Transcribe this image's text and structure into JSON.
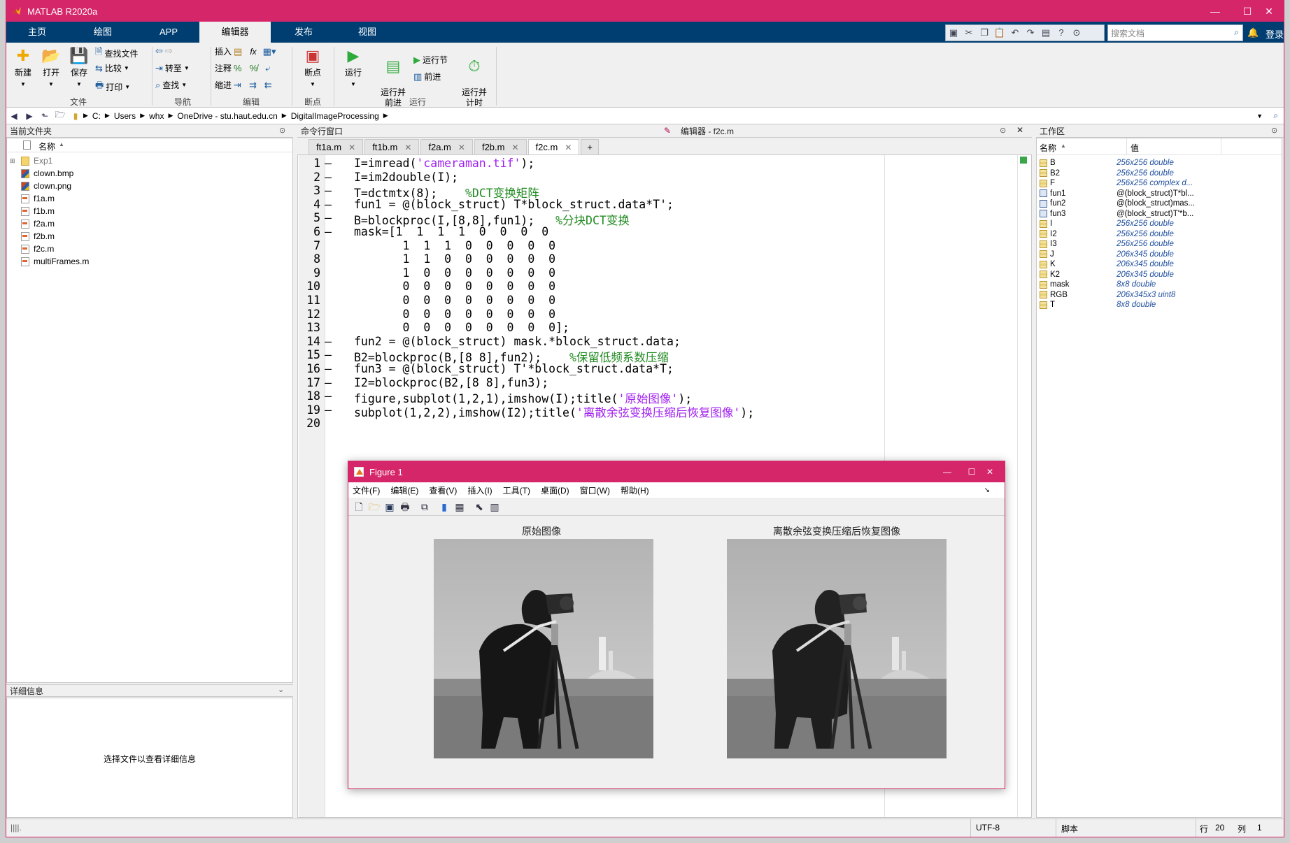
{
  "app": {
    "title": "MATLAB R2020a",
    "login_label": "登录"
  },
  "window_controls": {
    "minimize": "—",
    "maximize": "☐",
    "close": "✕"
  },
  "tabs": [
    {
      "label": "主页"
    },
    {
      "label": "绘图"
    },
    {
      "label": "APP"
    },
    {
      "label": "编辑器",
      "active": true
    },
    {
      "label": "发布"
    },
    {
      "label": "视图"
    }
  ],
  "search": {
    "placeholder": "搜索文档"
  },
  "ribbon": {
    "file": {
      "group_label": "文件",
      "new": "新建",
      "open": "打开",
      "save": "保存",
      "find_files": "查找文件",
      "compare": "比较",
      "print": "打印"
    },
    "navigate": {
      "group_label": "导航",
      "goto": "转至",
      "find": "查找"
    },
    "edit": {
      "group_label": "编辑",
      "insert": "插入",
      "comment": "注释",
      "indent": "缩进",
      "fx": "fx"
    },
    "breakpoints": {
      "group_label": "断点",
      "breakpoints": "断点"
    },
    "run": {
      "group_label": "运行",
      "run": "运行",
      "run_advance": "运行并\n前进",
      "run_section": "运行节",
      "advance": "前进",
      "run_time": "运行并\n计时"
    }
  },
  "address": {
    "crumbs": [
      "C:",
      "Users",
      "whx",
      "OneDrive - stu.haut.edu.cn",
      "DigitalImageProcessing"
    ]
  },
  "current_folder": {
    "title": "当前文件夹",
    "column": "名称",
    "files": [
      {
        "name": "Exp1",
        "type": "folder"
      },
      {
        "name": "clown.bmp",
        "type": "img"
      },
      {
        "name": "clown.png",
        "type": "img"
      },
      {
        "name": "f1a.m",
        "type": "m"
      },
      {
        "name": "f1b.m",
        "type": "m"
      },
      {
        "name": "f2a.m",
        "type": "m"
      },
      {
        "name": "f2b.m",
        "type": "m"
      },
      {
        "name": "f2c.m",
        "type": "m"
      },
      {
        "name": "multiFrames.m",
        "type": "m"
      }
    ]
  },
  "details": {
    "title": "详细信息",
    "empty_text": "选择文件以查看详细信息"
  },
  "command_window": {
    "title": "命令行窗口"
  },
  "editor": {
    "title": "编辑器 - f2c.m",
    "tabs": [
      "ft1a.m",
      "ft1b.m",
      "f2a.m",
      "f2b.m",
      "f2c.m"
    ],
    "active_tab": "f2c.m",
    "add_tab": "+",
    "lines": [
      {
        "n": "1",
        "dash": "–",
        "parts": [
          [
            "I=imread(",
            ""
          ],
          [
            "'cameraman.tif'",
            "str"
          ],
          [
            ");",
            ""
          ]
        ]
      },
      {
        "n": "2",
        "dash": "–",
        "parts": [
          [
            "I=im2double(I);",
            ""
          ]
        ]
      },
      {
        "n": "3",
        "dash": "–",
        "parts": [
          [
            "T=dctmtx(8);    ",
            ""
          ],
          [
            "%DCT变换矩阵",
            "cmt"
          ]
        ]
      },
      {
        "n": "4",
        "dash": "–",
        "parts": [
          [
            "fun1 = @(block_struct) T*block_struct.data*T';",
            ""
          ]
        ]
      },
      {
        "n": "5",
        "dash": "–",
        "parts": [
          [
            "B=blockproc(I,[8,8],fun1);   ",
            ""
          ],
          [
            "%分块DCT变换",
            "cmt"
          ]
        ]
      },
      {
        "n": "6",
        "dash": "–",
        "parts": [
          [
            "mask=[1  1  1  1  0  0  0  0",
            ""
          ]
        ]
      },
      {
        "n": "7",
        "dash": "",
        "parts": [
          [
            "       1  1  1  0  0  0  0  0",
            ""
          ]
        ]
      },
      {
        "n": "8",
        "dash": "",
        "parts": [
          [
            "       1  1  0  0  0  0  0  0",
            ""
          ]
        ]
      },
      {
        "n": "9",
        "dash": "",
        "parts": [
          [
            "       1  0  0  0  0  0  0  0",
            ""
          ]
        ]
      },
      {
        "n": "10",
        "dash": "",
        "parts": [
          [
            "       0  0  0  0  0  0  0  0",
            ""
          ]
        ]
      },
      {
        "n": "11",
        "dash": "",
        "parts": [
          [
            "       0  0  0  0  0  0  0  0",
            ""
          ]
        ]
      },
      {
        "n": "12",
        "dash": "",
        "parts": [
          [
            "       0  0  0  0  0  0  0  0",
            ""
          ]
        ]
      },
      {
        "n": "13",
        "dash": "",
        "parts": [
          [
            "       0  0  0  0  0  0  0  0];",
            ""
          ]
        ]
      },
      {
        "n": "14",
        "dash": "–",
        "parts": [
          [
            "fun2 = @(block_struct) mask.*block_struct.data;",
            ""
          ]
        ]
      },
      {
        "n": "15",
        "dash": "–",
        "parts": [
          [
            "B2=blockproc(B,[8 8],fun2);    ",
            ""
          ],
          [
            "%保留低频系数压缩",
            "cmt"
          ]
        ]
      },
      {
        "n": "16",
        "dash": "–",
        "parts": [
          [
            "fun3 = @(block_struct) T'*block_struct.data*T;",
            ""
          ]
        ]
      },
      {
        "n": "17",
        "dash": "–",
        "parts": [
          [
            "I2=blockproc(B2,[8 8],fun3);",
            ""
          ]
        ]
      },
      {
        "n": "18",
        "dash": "–",
        "parts": [
          [
            "figure,subplot(1,2,1),imshow(I);title(",
            ""
          ],
          [
            "'原始图像'",
            "str"
          ],
          [
            ");",
            ""
          ]
        ]
      },
      {
        "n": "19",
        "dash": "–",
        "parts": [
          [
            "subplot(1,2,2),imshow(I2);title(",
            ""
          ],
          [
            "'离散余弦变换压缩后恢复图像'",
            "str"
          ],
          [
            ");",
            ""
          ]
        ]
      },
      {
        "n": "20",
        "dash": "",
        "parts": [
          [
            "",
            ""
          ]
        ]
      }
    ]
  },
  "workspace": {
    "title": "工作区",
    "col_name": "名称",
    "col_value": "值",
    "vars": [
      {
        "name": "B",
        "value": "256x256 double",
        "kind": "grid"
      },
      {
        "name": "B2",
        "value": "256x256 double",
        "kind": "grid"
      },
      {
        "name": "F",
        "value": "256x256 complex d...",
        "kind": "grid"
      },
      {
        "name": "fun1",
        "value": "@(block_struct)T*bl...",
        "kind": "fn"
      },
      {
        "name": "fun2",
        "value": "@(block_struct)mas...",
        "kind": "fn"
      },
      {
        "name": "fun3",
        "value": "@(block_struct)T'*b...",
        "kind": "fn"
      },
      {
        "name": "I",
        "value": "256x256 double",
        "kind": "grid"
      },
      {
        "name": "I2",
        "value": "256x256 double",
        "kind": "grid"
      },
      {
        "name": "I3",
        "value": "256x256 double",
        "kind": "grid"
      },
      {
        "name": "J",
        "value": "206x345 double",
        "kind": "grid"
      },
      {
        "name": "K",
        "value": "206x345 double",
        "kind": "grid"
      },
      {
        "name": "K2",
        "value": "206x345 double",
        "kind": "grid"
      },
      {
        "name": "mask",
        "value": "8x8 double",
        "kind": "grid"
      },
      {
        "name": "RGB",
        "value": "206x345x3 uint8",
        "kind": "grid"
      },
      {
        "name": "T",
        "value": "8x8 double",
        "kind": "grid"
      }
    ]
  },
  "statusbar": {
    "encoding": "UTF-8",
    "mode": "脚本",
    "row_label": "行",
    "row": "20",
    "col_label": "列",
    "col": "1"
  },
  "figure": {
    "title": "Figure 1",
    "menu": [
      "文件(F)",
      "编辑(E)",
      "查看(V)",
      "插入(I)",
      "工具(T)",
      "桌面(D)",
      "窗口(W)",
      "帮助(H)"
    ],
    "left_title": "原始图像",
    "right_title": "离散余弦变换压缩后恢复图像"
  }
}
